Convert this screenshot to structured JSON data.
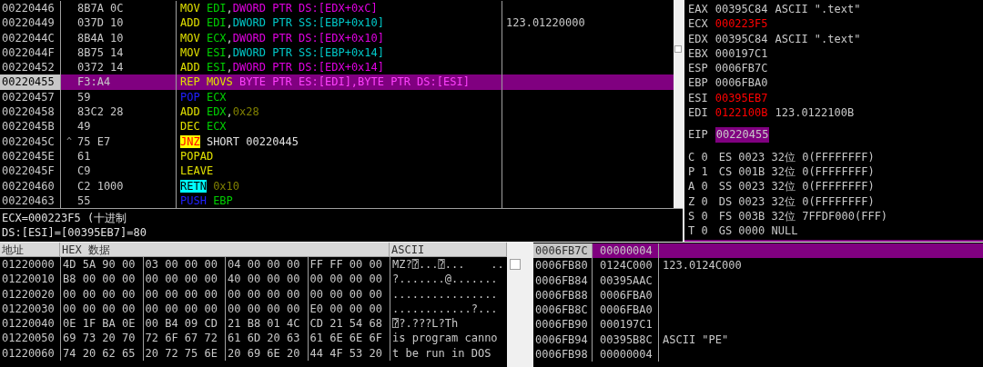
{
  "disassembly": {
    "rows": [
      {
        "address": "00220446",
        "hex": "8B7A 0C",
        "selected": false,
        "instruction": [
          {
            "text": "MOV",
            "kind": "mnemonic"
          },
          {
            "text": "EDI",
            "kind": "register"
          },
          {
            "text": ",",
            "kind": "punct"
          },
          {
            "text": "DWORD PTR DS:[EDX+0xC]",
            "kind": "memory"
          }
        ]
      },
      {
        "address": "00220449",
        "hex": "037D 10",
        "selected": false,
        "comment": "123.01220000",
        "instruction": [
          {
            "text": "ADD",
            "kind": "mnemonic"
          },
          {
            "text": "EDI",
            "kind": "register"
          },
          {
            "text": ",",
            "kind": "punct"
          },
          {
            "text": "DWORD PTR SS:[EBP+0x10]",
            "kind": "stackmem"
          }
        ]
      },
      {
        "address": "0022044C",
        "hex": "8B4A 10",
        "selected": false,
        "instruction": [
          {
            "text": "MOV",
            "kind": "mnemonic"
          },
          {
            "text": "ECX",
            "kind": "register"
          },
          {
            "text": ",",
            "kind": "punct"
          },
          {
            "text": "DWORD PTR DS:[EDX+0x10]",
            "kind": "memory"
          }
        ]
      },
      {
        "address": "0022044F",
        "hex": "8B75 14",
        "selected": false,
        "instruction": [
          {
            "text": "MOV",
            "kind": "mnemonic"
          },
          {
            "text": "ESI",
            "kind": "register"
          },
          {
            "text": ",",
            "kind": "punct"
          },
          {
            "text": "DWORD PTR SS:[EBP+0x14]",
            "kind": "stackmem"
          }
        ]
      },
      {
        "address": "00220452",
        "hex": "0372 14",
        "selected": false,
        "instruction": [
          {
            "text": "ADD",
            "kind": "mnemonic"
          },
          {
            "text": "ESI",
            "kind": "register"
          },
          {
            "text": ",",
            "kind": "punct"
          },
          {
            "text": "DWORD PTR DS:[EDX+0x14]",
            "kind": "memory"
          }
        ]
      },
      {
        "address": "00220455",
        "hex": "F3:A4",
        "selected": true,
        "instruction": [
          {
            "text": "REP MOVS",
            "kind": "mnemonic"
          },
          {
            "text": "BYTE PTR ES:[EDI],BYTE PTR DS:[ESI]",
            "kind": "memory"
          }
        ]
      },
      {
        "address": "00220457",
        "hex": "59",
        "selected": false,
        "instruction": [
          {
            "text": "POP",
            "kind": "stackop"
          },
          {
            "text": "ECX",
            "kind": "register"
          }
        ]
      },
      {
        "address": "00220458",
        "hex": "83C2 28",
        "selected": false,
        "instruction": [
          {
            "text": "ADD",
            "kind": "mnemonic"
          },
          {
            "text": "EDX",
            "kind": "register"
          },
          {
            "text": ",",
            "kind": "punct"
          },
          {
            "text": "0x28",
            "kind": "immediate"
          }
        ]
      },
      {
        "address": "0022045B",
        "hex": "49",
        "selected": false,
        "instruction": [
          {
            "text": "DEC",
            "kind": "mnemonic"
          },
          {
            "text": "ECX",
            "kind": "register"
          }
        ]
      },
      {
        "address": "0022045C",
        "marker": "^",
        "hex": "75 E7",
        "selected": false,
        "instruction": [
          {
            "text": "JNZ",
            "kind": "jump"
          },
          {
            "text": "SHORT 00220445",
            "kind": "plain"
          }
        ]
      },
      {
        "address": "0022045E",
        "hex": "61",
        "selected": false,
        "instruction": [
          {
            "text": "POPAD",
            "kind": "mnemonic"
          }
        ]
      },
      {
        "address": "0022045F",
        "hex": "C9",
        "selected": false,
        "instruction": [
          {
            "text": "LEAVE",
            "kind": "mnemonic"
          }
        ]
      },
      {
        "address": "00220460",
        "hex": "C2 1000",
        "selected": false,
        "instruction": [
          {
            "text": "RETN",
            "kind": "return"
          },
          {
            "text": "0x10",
            "kind": "immediate"
          }
        ]
      },
      {
        "address": "00220463",
        "hex": "55",
        "selected": false,
        "instruction": [
          {
            "text": "PUSH",
            "kind": "stackop"
          },
          {
            "text": "EBP",
            "kind": "register"
          }
        ]
      }
    ]
  },
  "registers": [
    {
      "name": "EAX",
      "value": "00395C84",
      "changed": false,
      "comment": "ASCII \".text\""
    },
    {
      "name": "ECX",
      "value": "000223F5",
      "changed": true
    },
    {
      "name": "EDX",
      "value": "00395C84",
      "changed": false,
      "comment": "ASCII \".text\""
    },
    {
      "name": "EBX",
      "value": "000197C1",
      "changed": false
    },
    {
      "name": "ESP",
      "value": "0006FB7C",
      "changed": false
    },
    {
      "name": "EBP",
      "value": "0006FBA0",
      "changed": false
    },
    {
      "name": "ESI",
      "value": "00395EB7",
      "changed": true
    },
    {
      "name": "EDI",
      "value": "0122100B",
      "changed": true,
      "comment": "123.0122100B"
    }
  ],
  "eip": {
    "name": "EIP",
    "value": "00220455"
  },
  "flags": [
    {
      "flag": "C 0",
      "segment": "ES 0023 32位 0(FFFFFFFF)"
    },
    {
      "flag": "P 1",
      "segment": "CS 001B 32位 0(FFFFFFFF)"
    },
    {
      "flag": "A 0",
      "segment": "SS 0023 32位 0(FFFFFFFF)"
    },
    {
      "flag": "Z 0",
      "segment": "DS 0023 32位 0(FFFFFFFF)"
    },
    {
      "flag": "S 0",
      "segment": "FS 003B 32位 7FFDF000(FFF)"
    },
    {
      "flag": "T 0",
      "segment": "GS 0000 NULL"
    }
  ],
  "info": [
    "ECX=000223F5 (十进制",
    "DS:[ESI]=[00395EB7]=80"
  ],
  "dump": {
    "columns": [
      "地址",
      "HEX 数据",
      "ASCII"
    ],
    "rows": [
      {
        "address": "01220000",
        "hex": [
          "4D 5A 90 00",
          "03 00 00 00",
          "04 00 00 00",
          "FF FF 00 00"
        ],
        "ascii": "MZ?⍰...⍰...    .."
      },
      {
        "address": "01220010",
        "hex": [
          "B8 00 00 00",
          "00 00 00 00",
          "40 00 00 00",
          "00 00 00 00"
        ],
        "ascii": "?.......@......."
      },
      {
        "address": "01220020",
        "hex": [
          "00 00 00 00",
          "00 00 00 00",
          "00 00 00 00",
          "00 00 00 00"
        ],
        "ascii": "................"
      },
      {
        "address": "01220030",
        "hex": [
          "00 00 00 00",
          "00 00 00 00",
          "00 00 00 00",
          "E0 00 00 00"
        ],
        "ascii": "............?..."
      },
      {
        "address": "01220040",
        "hex": [
          "0E 1F BA 0E",
          "00 B4 09 CD",
          "21 B8 01 4C",
          "CD 21 54 68"
        ],
        "ascii": "⍰?.???L?Th"
      },
      {
        "address": "01220050",
        "hex": [
          "69 73 20 70",
          "72 6F 67 72",
          "61 6D 20 63",
          "61 6E 6E 6F"
        ],
        "ascii": "is program canno"
      },
      {
        "address": "01220060",
        "hex": [
          "74 20 62 65",
          "20 72 75 6E",
          "20 69 6E 20",
          "44 4F 53 20"
        ],
        "ascii": "t be run in DOS"
      }
    ]
  },
  "stack": [
    {
      "address": "0006FB7C",
      "value": "00000004",
      "selected": true
    },
    {
      "address": "0006FB80",
      "value": "0124C000",
      "selected": false,
      "comment": "123.0124C000"
    },
    {
      "address": "0006FB84",
      "value": "00395AAC",
      "selected": false
    },
    {
      "address": "0006FB88",
      "value": "0006FBA0",
      "selected": false
    },
    {
      "address": "0006FB8C",
      "value": "0006FBA0",
      "selected": false
    },
    {
      "address": "0006FB90",
      "value": "000197C1",
      "selected": false
    },
    {
      "address": "0006FB94",
      "value": "00395B8C",
      "selected": false,
      "comment": "ASCII \"PE\""
    },
    {
      "address": "0006FB98",
      "value": "00000004",
      "selected": false
    }
  ]
}
